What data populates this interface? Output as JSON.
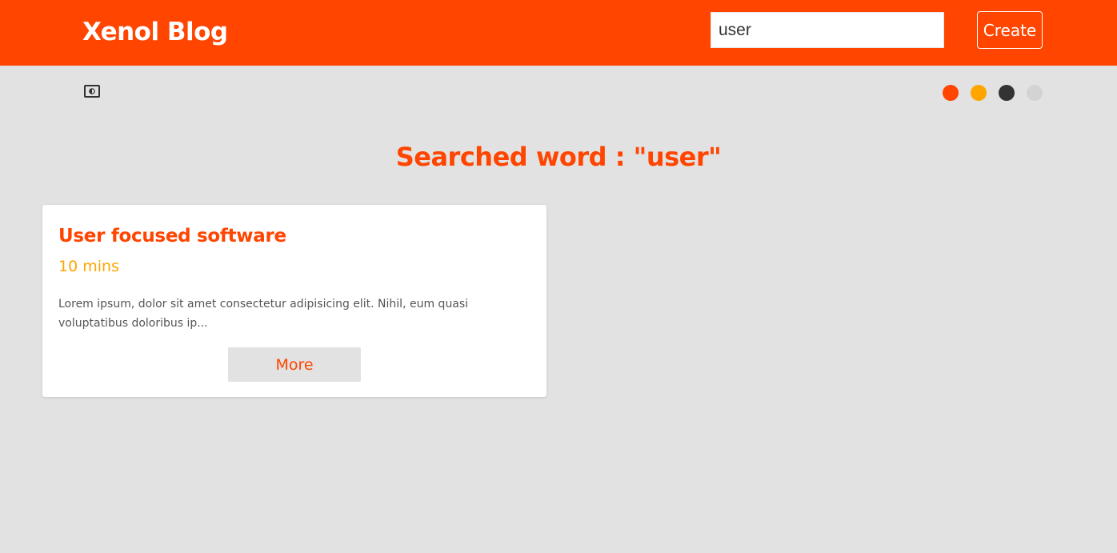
{
  "header": {
    "title": "Xenol Blog",
    "search": {
      "value": "user",
      "placeholder": ""
    },
    "create_label": "Create"
  },
  "toolbar": {
    "theme_toggle_icon": "contrast-icon",
    "color_options": [
      {
        "name": "orange-red",
        "color": "#ff4500"
      },
      {
        "name": "orange",
        "color": "#ffa500"
      },
      {
        "name": "dark",
        "color": "#333333"
      },
      {
        "name": "light",
        "color": "#d3d3d3"
      }
    ]
  },
  "main": {
    "heading": "Searched word : \"user\"",
    "results": [
      {
        "title": "User focused software",
        "read_time": "10 mins",
        "excerpt": "Lorem ipsum, dolor sit amet consectetur adipisicing elit. Nihil, eum quasi voluptatibus doloribus ip...",
        "more_label": "More"
      }
    ]
  },
  "colors": {
    "accent": "#ff4500",
    "secondary": "#ffa500",
    "background": "#e2e2e2",
    "card": "#ffffff"
  }
}
